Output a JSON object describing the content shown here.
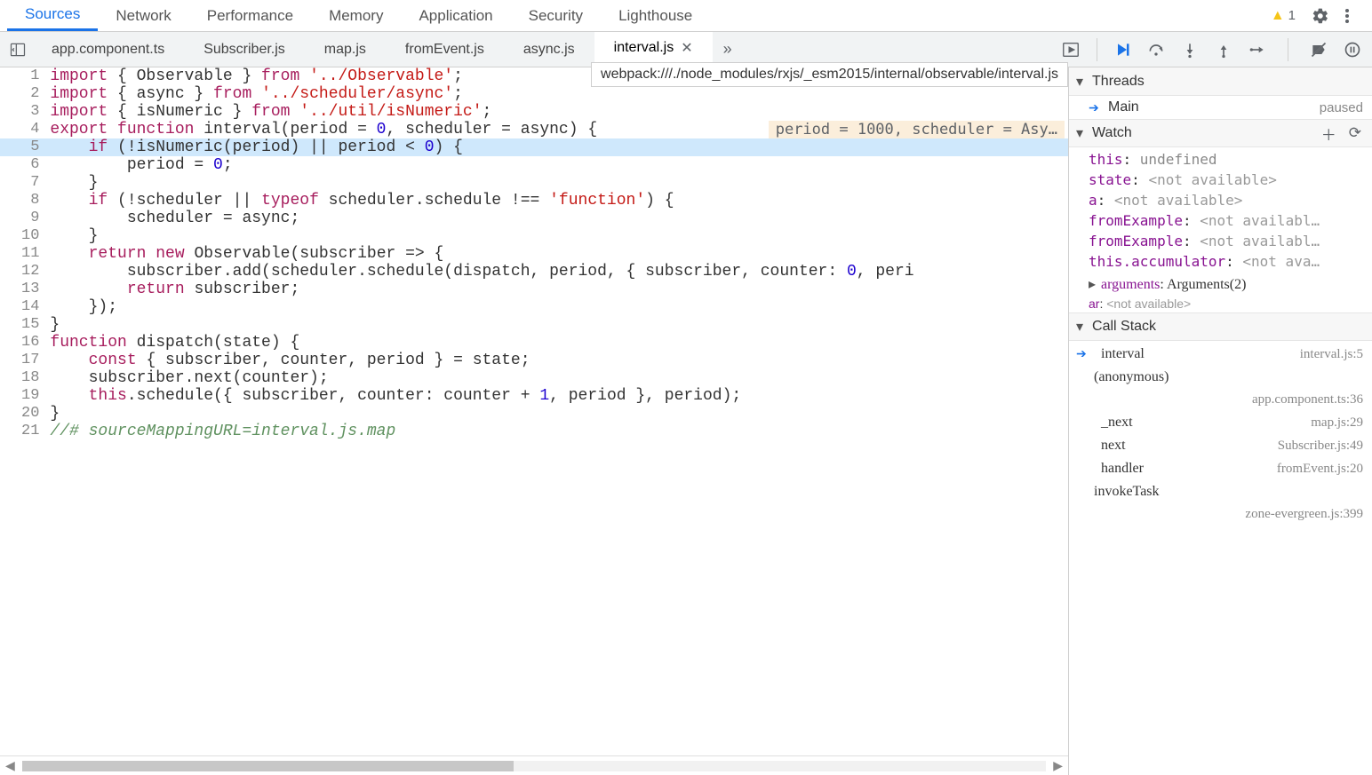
{
  "topTabs": [
    "Sources",
    "Network",
    "Performance",
    "Memory",
    "Application",
    "Security",
    "Lighthouse"
  ],
  "activeTopTab": "Sources",
  "warningCount": "1",
  "fileTabs": [
    {
      "label": "app.component.ts",
      "active": false
    },
    {
      "label": "Subscriber.js",
      "active": false
    },
    {
      "label": "map.js",
      "active": false
    },
    {
      "label": "fromEvent.js",
      "active": false
    },
    {
      "label": "async.js",
      "active": false
    },
    {
      "label": "interval.js",
      "active": true
    }
  ],
  "pathTooltip": "webpack:///./node_modules/rxjs/_esm2015/internal/observable/interval.js",
  "inlineValues": "period = 1000, scheduler = Asy…",
  "highlightedLine": 5,
  "code": [
    {
      "n": 1,
      "html": "<span class='kw'>import</span> { Observable } <span class='kw'>from</span> <span class='str'>'../Observable'</span>;"
    },
    {
      "n": 2,
      "html": "<span class='kw'>import</span> { async } <span class='kw'>from</span> <span class='str'>'../scheduler/async'</span>;"
    },
    {
      "n": 3,
      "html": "<span class='kw'>import</span> { isNumeric } <span class='kw'>from</span> <span class='str'>'../util/isNumeric'</span>;"
    },
    {
      "n": 4,
      "html": "<span class='kw'>export function</span> interval(period = <span class='num'>0</span>, scheduler = async) {",
      "inline": true
    },
    {
      "n": 5,
      "html": "    <span class='kw'>if</span> (!isNumeric(period) || period &lt; <span class='num'>0</span>) {"
    },
    {
      "n": 6,
      "html": "        period = <span class='num'>0</span>;"
    },
    {
      "n": 7,
      "html": "    }"
    },
    {
      "n": 8,
      "html": "    <span class='kw'>if</span> (!scheduler || <span class='kw'>typeof</span> scheduler.schedule !== <span class='str'>'function'</span>) {"
    },
    {
      "n": 9,
      "html": "        scheduler = async;"
    },
    {
      "n": 10,
      "html": "    }"
    },
    {
      "n": 11,
      "html": "    <span class='kw'>return new</span> Observable(subscriber =&gt; {"
    },
    {
      "n": 12,
      "html": "        subscriber.add(scheduler.schedule(dispatch, period, { subscriber, counter: <span class='num'>0</span>, peri"
    },
    {
      "n": 13,
      "html": "        <span class='kw'>return</span> subscriber;"
    },
    {
      "n": 14,
      "html": "    });"
    },
    {
      "n": 15,
      "html": "}"
    },
    {
      "n": 16,
      "html": "<span class='kw'>function</span> dispatch(state) {"
    },
    {
      "n": 17,
      "html": "    <span class='kw'>const</span> { subscriber, counter, period } = state;"
    },
    {
      "n": 18,
      "html": "    subscriber.next(counter);"
    },
    {
      "n": 19,
      "html": "    <span class='kw'>this</span>.schedule({ subscriber, counter: counter + <span class='num'>1</span>, period }, period);"
    },
    {
      "n": 20,
      "html": "}"
    },
    {
      "n": 21,
      "html": "<span class='cm'>//# sourceMappingURL=interval.js.map</span>"
    }
  ],
  "side": {
    "threads_h": "Threads",
    "thread": {
      "name": "Main",
      "state": "paused"
    },
    "watch_h": "Watch",
    "watch": [
      {
        "k": "this",
        "v": "undefined",
        "cls": "v-undef"
      },
      {
        "k": "state",
        "v": "<not available>",
        "cls": "na"
      },
      {
        "k": "a",
        "v": "<not available>",
        "cls": "na"
      },
      {
        "k": "fromExample",
        "v": "<not availabl…",
        "cls": "na"
      },
      {
        "k": "fromExample",
        "v": "<not availabl…",
        "cls": "na"
      },
      {
        "k": "this.accumulator",
        "v": "<not ava…",
        "cls": "na"
      }
    ],
    "watchArgs": {
      "k": "arguments",
      "v": "Arguments(2)"
    },
    "watchAr": {
      "k": "ar",
      "v": "<not available>"
    },
    "cs_h": "Call Stack",
    "callStack": [
      {
        "fn": "interval",
        "loc": "interval.js:5",
        "current": true
      },
      {
        "fn": "(anonymous)",
        "loc": "app.component.ts:36",
        "two": true
      },
      {
        "fn": "_next",
        "loc": "map.js:29"
      },
      {
        "fn": "next",
        "loc": "Subscriber.js:49"
      },
      {
        "fn": "handler",
        "loc": "fromEvent.js:20"
      },
      {
        "fn": "invokeTask",
        "loc": "zone-evergreen.js:399",
        "two": true
      }
    ]
  }
}
